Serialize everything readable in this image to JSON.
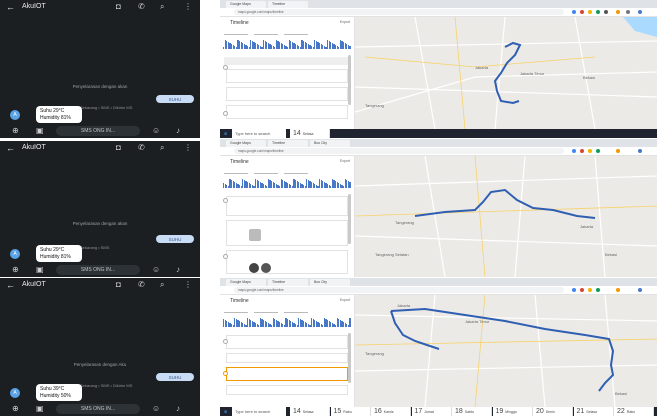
{
  "rows": [
    {
      "phone": {
        "contact": "AkuIOT",
        "system_message": "Penyelarasan dengan akan",
        "sent_message": "SUHU",
        "meta": "Sekarang • SMS • Dikirim MS",
        "avatar_letter": "A",
        "reply_line1": "Suhu 29°C",
        "reply_line2": "Humidity 81%",
        "input_placeholder": "SMS ONG IN..."
      },
      "browser": {
        "tabs": [
          "Google Maps",
          "Timeline"
        ],
        "url": "maps.google.com/maps/timeline",
        "panel_title": "Timeline",
        "export_label": "Export",
        "taskbar_search": "Type here to search",
        "days": [
          {
            "num": "14",
            "label": "Selasa"
          }
        ]
      }
    },
    {
      "phone": {
        "contact": "AkuIOT",
        "system_message": "Penyelarasan dengan akan",
        "sent_message": "SUHU",
        "meta": "Sekarang • SMS",
        "avatar_letter": "A",
        "reply_line1": "Suhu 29°C",
        "reply_line2": "Humidity 81%",
        "input_placeholder": "SMS ONG IN..."
      },
      "browser": {
        "tabs": [
          "Google Maps",
          "Timeline",
          "Bus City"
        ],
        "url": "maps.google.com/maps/timeline",
        "panel_title": "Timeline",
        "export_label": "Export",
        "taskbar_search": "",
        "days": []
      }
    },
    {
      "phone": {
        "contact": "AkuIOT",
        "system_message": "Penyelarasan dengan Aku",
        "sent_message": "SUHU",
        "meta": "Sekarang • SMS • Dikirim MS",
        "avatar_letter": "A",
        "reply_line1": "Suhu 39°C",
        "reply_line2": "Humidity 50%",
        "input_placeholder": "SMS ONG IN..."
      },
      "browser": {
        "tabs": [
          "Google Maps",
          "Timeline",
          "Bus City"
        ],
        "url": "maps.google.com/maps/timeline",
        "panel_title": "Timeline",
        "export_label": "Export",
        "taskbar_search": "Type here to search",
        "days": [
          {
            "num": "14",
            "label": "Selasa"
          },
          {
            "num": "15",
            "label": "Rabu"
          },
          {
            "num": "16",
            "label": "Kamis"
          },
          {
            "num": "17",
            "label": "Jumat"
          },
          {
            "num": "18",
            "label": "Sabtu"
          },
          {
            "num": "19",
            "label": "Minggu"
          },
          {
            "num": "20",
            "label": "Senin"
          },
          {
            "num": "21",
            "label": "Selasa"
          },
          {
            "num": "22",
            "label": "Rabu"
          }
        ]
      }
    }
  ],
  "colors": {
    "phone_bg": "#1c1f22",
    "sent_bubble": "#c9dcf5",
    "avatar": "#5aa3e6",
    "route": "#2f5fb3",
    "map_bg": "#eceae6",
    "taskbar": "#1f2430"
  },
  "icons": [
    "back-arrow-icon",
    "video-icon",
    "call-icon",
    "search-icon",
    "more-icon",
    "add-icon",
    "gallery-icon",
    "emoji-icon",
    "mic-icon"
  ]
}
